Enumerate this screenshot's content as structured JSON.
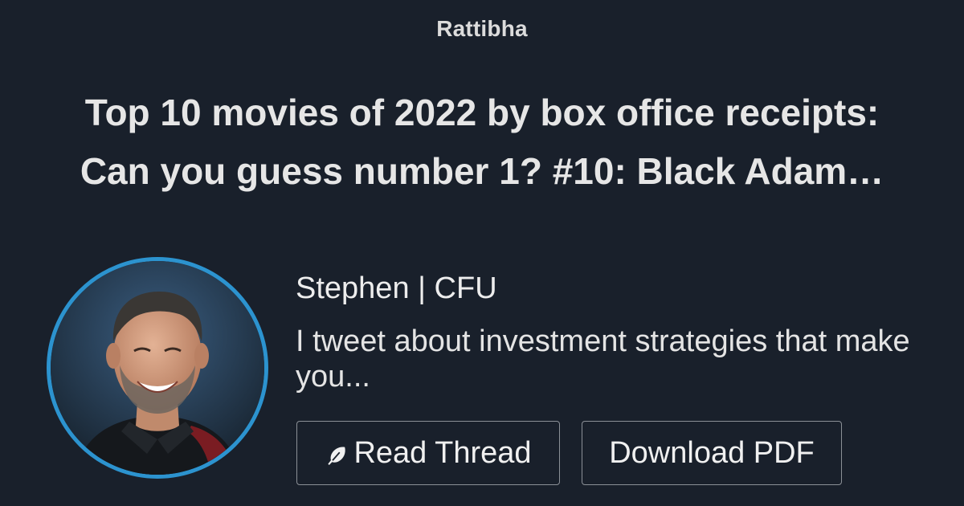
{
  "site": {
    "name": "Rattibha"
  },
  "thread": {
    "title": "Top 10 movies of 2022 by box office receipts: Can you guess number 1? #10: Black Adam…"
  },
  "author": {
    "name": "Stephen | CFU",
    "bio": "I tweet about investment strategies that make you..."
  },
  "actions": {
    "read_label": "Read Thread",
    "read_icon": "feather-icon",
    "pdf_label": "Download PDF"
  },
  "colors": {
    "background": "#19202b",
    "avatar_ring": "#2c93cf",
    "button_border": "#8b9097"
  }
}
